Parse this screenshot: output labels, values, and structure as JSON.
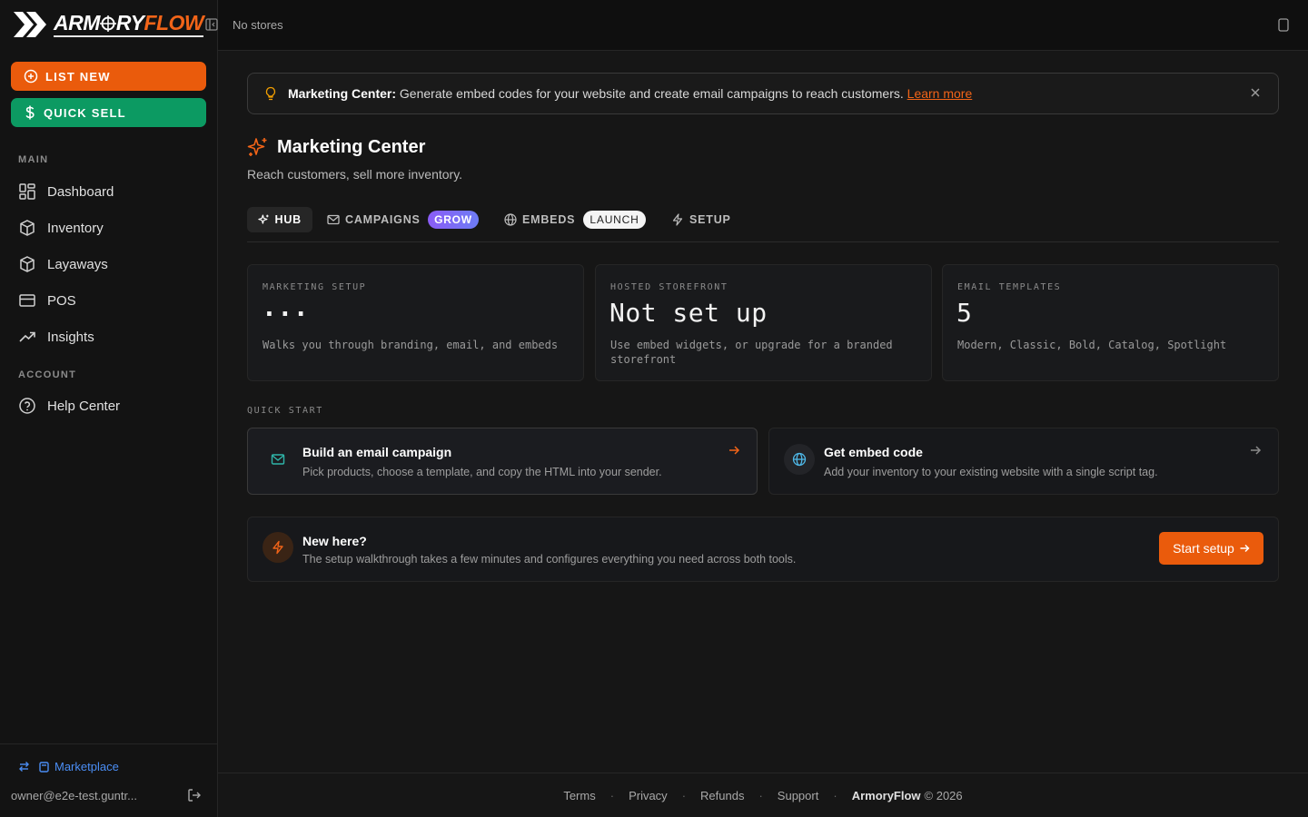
{
  "brand": {
    "logo_part1": "ARM",
    "logo_part2": "RY",
    "logo_part3": "FLOW",
    "accent": "#ea5b0c",
    "sell_color": "#0c9a62"
  },
  "topbar": {
    "store": "No stores"
  },
  "sidebar": {
    "list_new": "LIST NEW",
    "quick_sell": "QUICK SELL",
    "main_label": "MAIN",
    "items": [
      {
        "label": "Dashboard",
        "icon": "dashboard-icon"
      },
      {
        "label": "Inventory",
        "icon": "box-icon"
      },
      {
        "label": "Layaways",
        "icon": "box-icon"
      },
      {
        "label": "POS",
        "icon": "card-icon"
      },
      {
        "label": "Insights",
        "icon": "trend-icon"
      }
    ],
    "account_label": "ACCOUNT",
    "help": "Help Center",
    "marketplace": "Marketplace",
    "user": "owner@e2e-test.guntr..."
  },
  "banner": {
    "title": "Marketing Center:",
    "text": "Generate embed codes for your website and create email campaigns to reach customers.",
    "link": "Learn more"
  },
  "page": {
    "title": "Marketing Center",
    "subtitle": "Reach customers, sell more inventory."
  },
  "tabs": [
    {
      "label": "HUB"
    },
    {
      "label": "CAMPAIGNS",
      "badge": "GROW"
    },
    {
      "label": "EMBEDS",
      "badge": "LAUNCH"
    },
    {
      "label": "SETUP"
    }
  ],
  "cards": [
    {
      "label": "MARKETING SETUP",
      "value": "...",
      "desc": "Walks you through branding, email, and embeds"
    },
    {
      "label": "HOSTED STOREFRONT",
      "value": "Not set up",
      "desc": "Use embed widgets, or upgrade for a branded storefront"
    },
    {
      "label": "EMAIL TEMPLATES",
      "value": "5",
      "desc": "Modern, Classic, Bold, Catalog, Spotlight"
    }
  ],
  "quick_start": {
    "label": "QUICK START",
    "items": [
      {
        "title": "Build an email campaign",
        "desc": "Pick products, choose a template, and copy the HTML into your sender."
      },
      {
        "title": "Get embed code",
        "desc": "Add your inventory to your existing website with a single script tag."
      }
    ]
  },
  "new_here": {
    "title": "New here?",
    "desc": "The setup walkthrough takes a few minutes and configures everything you need across both tools.",
    "button": "Start setup"
  },
  "footer": {
    "links": [
      "Terms",
      "Privacy",
      "Refunds",
      "Support"
    ],
    "brand": "ArmoryFlow",
    "copyright": "© 2026"
  }
}
